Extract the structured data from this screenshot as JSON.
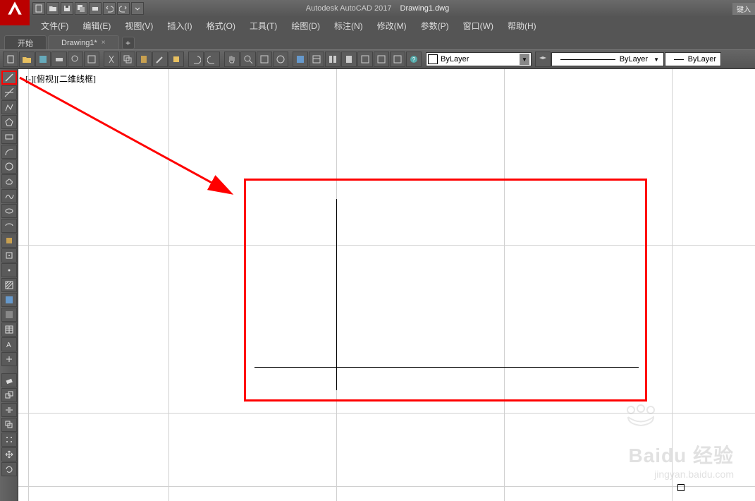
{
  "title": {
    "app": "Autodesk AutoCAD 2017",
    "doc": "Drawing1.dwg",
    "right_btn": "键入"
  },
  "menu": {
    "file": "文件(F)",
    "edit": "编辑(E)",
    "view": "视图(V)",
    "insert": "插入(I)",
    "format": "格式(O)",
    "tools": "工具(T)",
    "draw": "绘图(D)",
    "dimension": "标注(N)",
    "modify": "修改(M)",
    "param": "参数(P)",
    "window": "窗口(W)",
    "help": "帮助(H)"
  },
  "tabs": {
    "start": "开始",
    "drawing": "Drawing1*",
    "plus": "+"
  },
  "toolbar": {
    "layer": "ByLayer",
    "linetype": "ByLayer",
    "lineweight": "ByLayer"
  },
  "canvas": {
    "view_label": "[-][俯视][二维线框]"
  },
  "watermark": {
    "brand": "Baidu 经验",
    "url": "jingyan.baidu.com"
  },
  "icons": {
    "line": "line-tool",
    "pline": "polyline-tool",
    "circle": "circle-tool",
    "arc": "arc-tool",
    "rect": "rectangle-tool",
    "ellipse": "ellipse-tool",
    "hatch": "hatch-tool",
    "text": "text-tool"
  }
}
